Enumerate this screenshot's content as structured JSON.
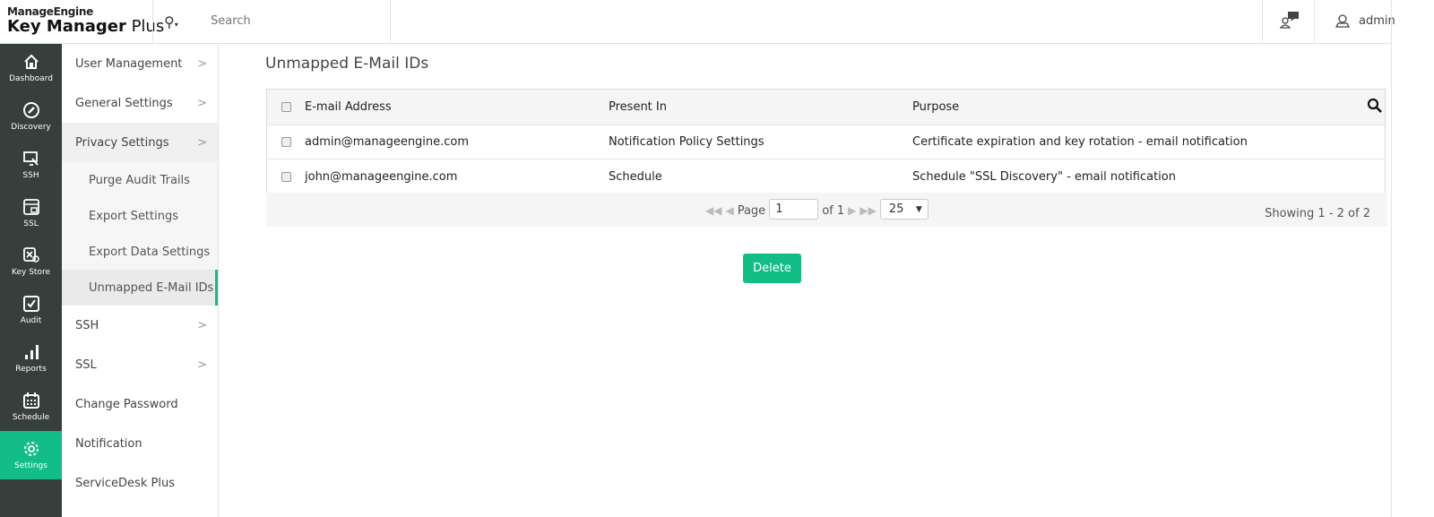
{
  "header": {
    "brand": "ManageEngine",
    "product_bold": "Key Manager",
    "product_rest": " Plus",
    "search_placeholder": "Search",
    "user": "admin"
  },
  "rail": [
    {
      "label": "Dashboard",
      "icon": "home-icon"
    },
    {
      "label": "Discovery",
      "icon": "compass-icon"
    },
    {
      "label": "SSH",
      "icon": "ssh-icon"
    },
    {
      "label": "SSL",
      "icon": "ssl-icon"
    },
    {
      "label": "Key Store",
      "icon": "key-store-icon"
    },
    {
      "label": "Audit",
      "icon": "audit-icon"
    },
    {
      "label": "Reports",
      "icon": "reports-icon"
    },
    {
      "label": "Schedule",
      "icon": "calendar-icon"
    },
    {
      "label": "Settings",
      "icon": "gear-icon",
      "active": true
    }
  ],
  "submenu": {
    "user_management": "User Management",
    "general_settings": "General Settings",
    "privacy_settings": "Privacy Settings",
    "privacy_children": [
      "Purge Audit Trails",
      "Export Settings",
      "Export Data Settings",
      "Unmapped E-Mail IDs"
    ],
    "ssh": "SSH",
    "ssl": "SSL",
    "change_password": "Change Password",
    "notification": "Notification",
    "servicedesk": "ServiceDesk Plus"
  },
  "main": {
    "title": "Unmapped E-Mail IDs",
    "columns": [
      "E-mail Address",
      "Present In",
      "Purpose"
    ],
    "rows": [
      [
        "admin@manageengine.com",
        "Notification Policy Settings",
        "Certificate expiration and key rotation - email notification"
      ],
      [
        "john@manageengine.com",
        "Schedule",
        "Schedule \"SSL Discovery\" - email notification"
      ]
    ],
    "pager": {
      "page_label": "Page",
      "page": "1",
      "of_label": "of 1",
      "page_size": "25",
      "showing": "Showing 1 - 2 of 2"
    },
    "delete_label": "Delete"
  },
  "colors": {
    "accent": "#12bd86",
    "rail": "#363f3c"
  }
}
